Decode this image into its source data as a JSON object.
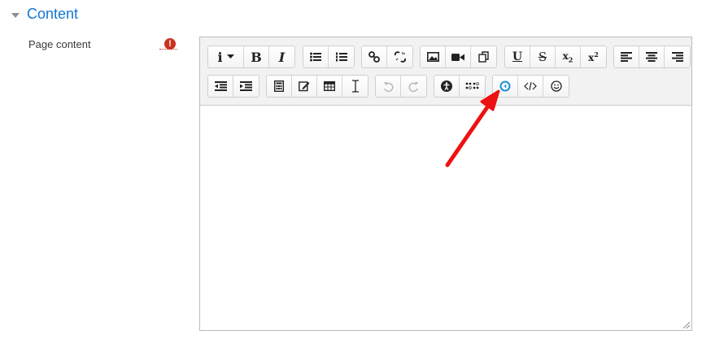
{
  "section": {
    "title": "Content"
  },
  "field": {
    "label": "Page content",
    "required_icon": "exclamation-circle-icon",
    "required_mark": "!"
  },
  "colors": {
    "title": "#1177d1",
    "required": "#ca3120",
    "annotation_arrow": "#ee1111",
    "accessibility_active": "#1a8fd6"
  },
  "toolbar": {
    "row1": [
      {
        "name": "paragraph-style",
        "label": "i",
        "dropdown": true
      },
      {
        "name": "bold",
        "label": "B"
      },
      {
        "name": "italic",
        "label": "I"
      },
      {
        "name": "unordered-list",
        "icon": "bulleted-list-icon"
      },
      {
        "name": "ordered-list",
        "icon": "numbered-list-icon"
      },
      {
        "name": "link",
        "icon": "link-icon"
      },
      {
        "name": "unlink",
        "icon": "unlink-icon"
      },
      {
        "name": "image",
        "icon": "image-icon"
      },
      {
        "name": "media",
        "icon": "video-camera-icon"
      },
      {
        "name": "manage-files",
        "icon": "files-icon"
      },
      {
        "name": "underline",
        "label": "U"
      },
      {
        "name": "strikethrough",
        "label": "S"
      },
      {
        "name": "subscript",
        "label": "x",
        "sub": "2"
      },
      {
        "name": "superscript",
        "label": "x",
        "sup": "2"
      },
      {
        "name": "align-left",
        "icon": "align-left-icon"
      },
      {
        "name": "align-center",
        "icon": "align-center-icon"
      },
      {
        "name": "align-right",
        "icon": "align-right-icon"
      }
    ],
    "row2": [
      {
        "name": "outdent",
        "icon": "outdent-icon"
      },
      {
        "name": "indent",
        "icon": "indent-icon"
      },
      {
        "name": "equation",
        "icon": "calculator-icon"
      },
      {
        "name": "special-character",
        "icon": "edit-icon"
      },
      {
        "name": "table",
        "icon": "table-icon"
      },
      {
        "name": "clear-formatting",
        "icon": "text-cursor-icon"
      },
      {
        "name": "undo",
        "icon": "undo-icon",
        "disabled": true
      },
      {
        "name": "redo",
        "icon": "redo-icon",
        "disabled": true
      },
      {
        "name": "accessibility-checker",
        "icon": "accessibility-icon"
      },
      {
        "name": "screenreader-helper",
        "icon": "braille-icon"
      },
      {
        "name": "record-rtc",
        "icon": "circle-chevron-icon"
      },
      {
        "name": "html",
        "icon": "code-icon"
      },
      {
        "name": "emoticon",
        "icon": "smiley-icon"
      }
    ]
  },
  "editor": {
    "content": ""
  }
}
